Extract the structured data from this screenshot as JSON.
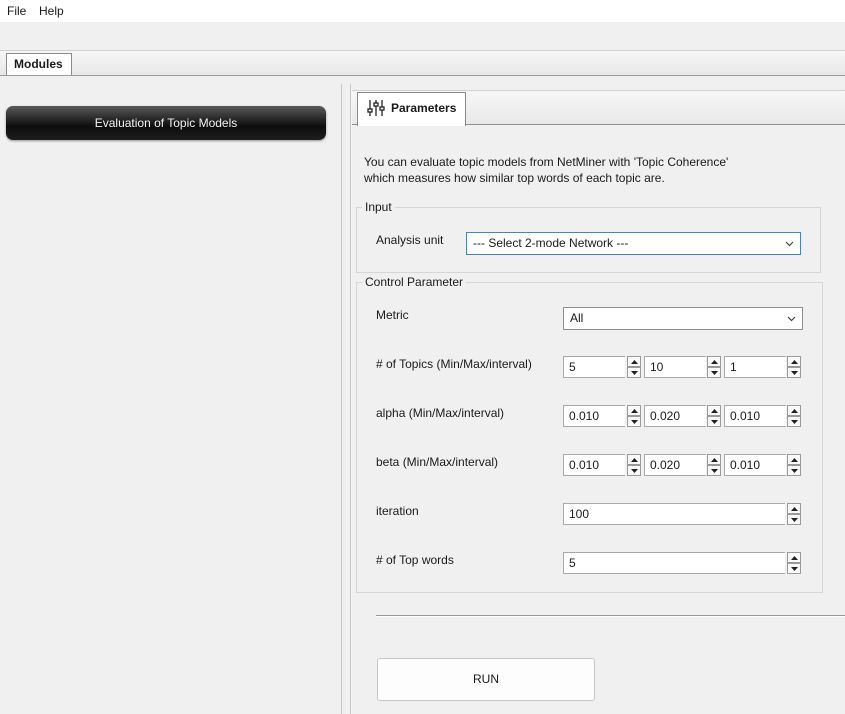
{
  "menu": {
    "items": [
      "File",
      "Help"
    ]
  },
  "modules_tab": {
    "label": "Modules"
  },
  "module_list": {
    "items": [
      "Evaluation of Topic Models"
    ]
  },
  "parameters_tab": {
    "label": "Parameters",
    "icon": "sliders-icon"
  },
  "description": {
    "line1": "You can evaluate topic models from NetMiner with 'Topic Coherence'",
    "line2": "which measures how similar top words of each topic are."
  },
  "input_group": {
    "title": "Input",
    "analysis_unit_label": "Analysis unit",
    "analysis_unit_value": "--- Select 2-mode Network ---"
  },
  "control_group": {
    "title": "Control Parameter",
    "metric_label": "Metric",
    "metric_value": "All",
    "topics": {
      "label": "# of Topics (Min/Max/interval)",
      "min": "5",
      "max": "10",
      "interval": "1"
    },
    "alpha": {
      "label": "alpha (Min/Max/interval)",
      "min": "0.010",
      "max": "0.020",
      "interval": "0.010"
    },
    "beta": {
      "label": "beta (Min/Max/interval)",
      "min": "0.010",
      "max": "0.020",
      "interval": "0.010"
    },
    "iteration": {
      "label": "iteration",
      "value": "100"
    },
    "top_words": {
      "label": "# of Top words",
      "value": "5"
    }
  },
  "run_button": {
    "label": "RUN"
  }
}
